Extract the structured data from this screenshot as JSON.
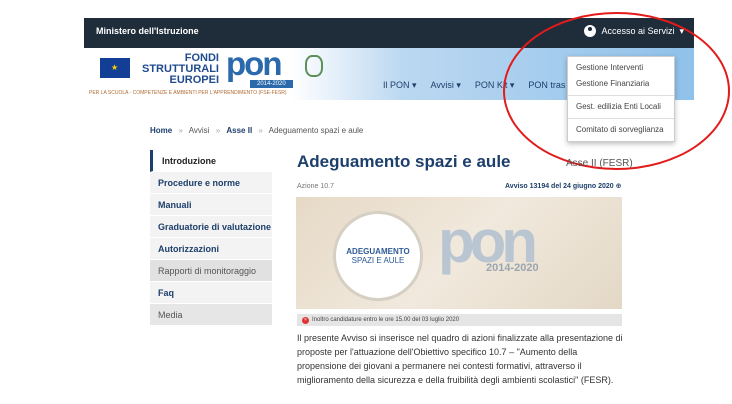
{
  "topbar": {
    "ministry": "Ministero dell'Istruzione",
    "access_label": "Accesso ai Servizi",
    "access_caret": "▾"
  },
  "header": {
    "fondi_line1": "FONDI",
    "fondi_line2": "STRUTTURALI",
    "fondi_line3": "EUROPEI",
    "pon_logo": "pon",
    "pon_years": "2014-2020",
    "tagline": "PER LA SCUOLA - COMPETENZE E AMBIENTI PER L'APPRENDIMENTO (FSE-FESR)",
    "nav": [
      {
        "label": "Il PON ▾"
      },
      {
        "label": "Avvisi ▾"
      },
      {
        "label": "PON Kit ▾"
      },
      {
        "label": "PON tras"
      }
    ]
  },
  "dropdown": {
    "items": [
      "Gestione Interventi",
      "Gestione Finanziaria",
      "Gest. edilizia Enti Locali",
      "Comitato di sorveglianza"
    ]
  },
  "breadcrumb": {
    "home": "Home",
    "avvisi": "Avvisi",
    "asse": "Asse II",
    "current": "Adeguamento spazi e aule",
    "separator": "»"
  },
  "sidebar": {
    "items": [
      "Introduzione",
      "Procedure e norme",
      "Manuali",
      "Graduatorie di valutazione",
      "Autorizzazioni",
      "Rapporti di monitoraggio",
      "Faq",
      "Media"
    ]
  },
  "main": {
    "title": "Adeguamento spazi e aule",
    "asse_label": "Asse II (FESR)",
    "azione": "Azione 10.7",
    "avviso": "Avviso 13194 del 24 giugno 2020 ⊕",
    "banner_badge_line1": "ADEGUAMENTO",
    "banner_badge_line2": "SPAZI E AULE",
    "banner_pon": "pon",
    "banner_years": "2014-2020",
    "alert": "Inoltro candidature entro le ore 15.00 del 03 luglio 2020",
    "body": "Il presente Avviso si inserisce nel quadro di azioni finalizzate alla presentazione di proposte per l'attuazione dell'Obiettivo specifico 10.7 – \"Aumento della propensione dei giovani a permanere nei contesti formativi, attraverso il miglioramento della sicurezza e della fruibilità degli ambienti scolastici\" (FESR)."
  },
  "colors": {
    "topbar": "#1f2d3b",
    "brand_blue": "#1d3f6b",
    "annotation_circle": "#e21b1b"
  }
}
